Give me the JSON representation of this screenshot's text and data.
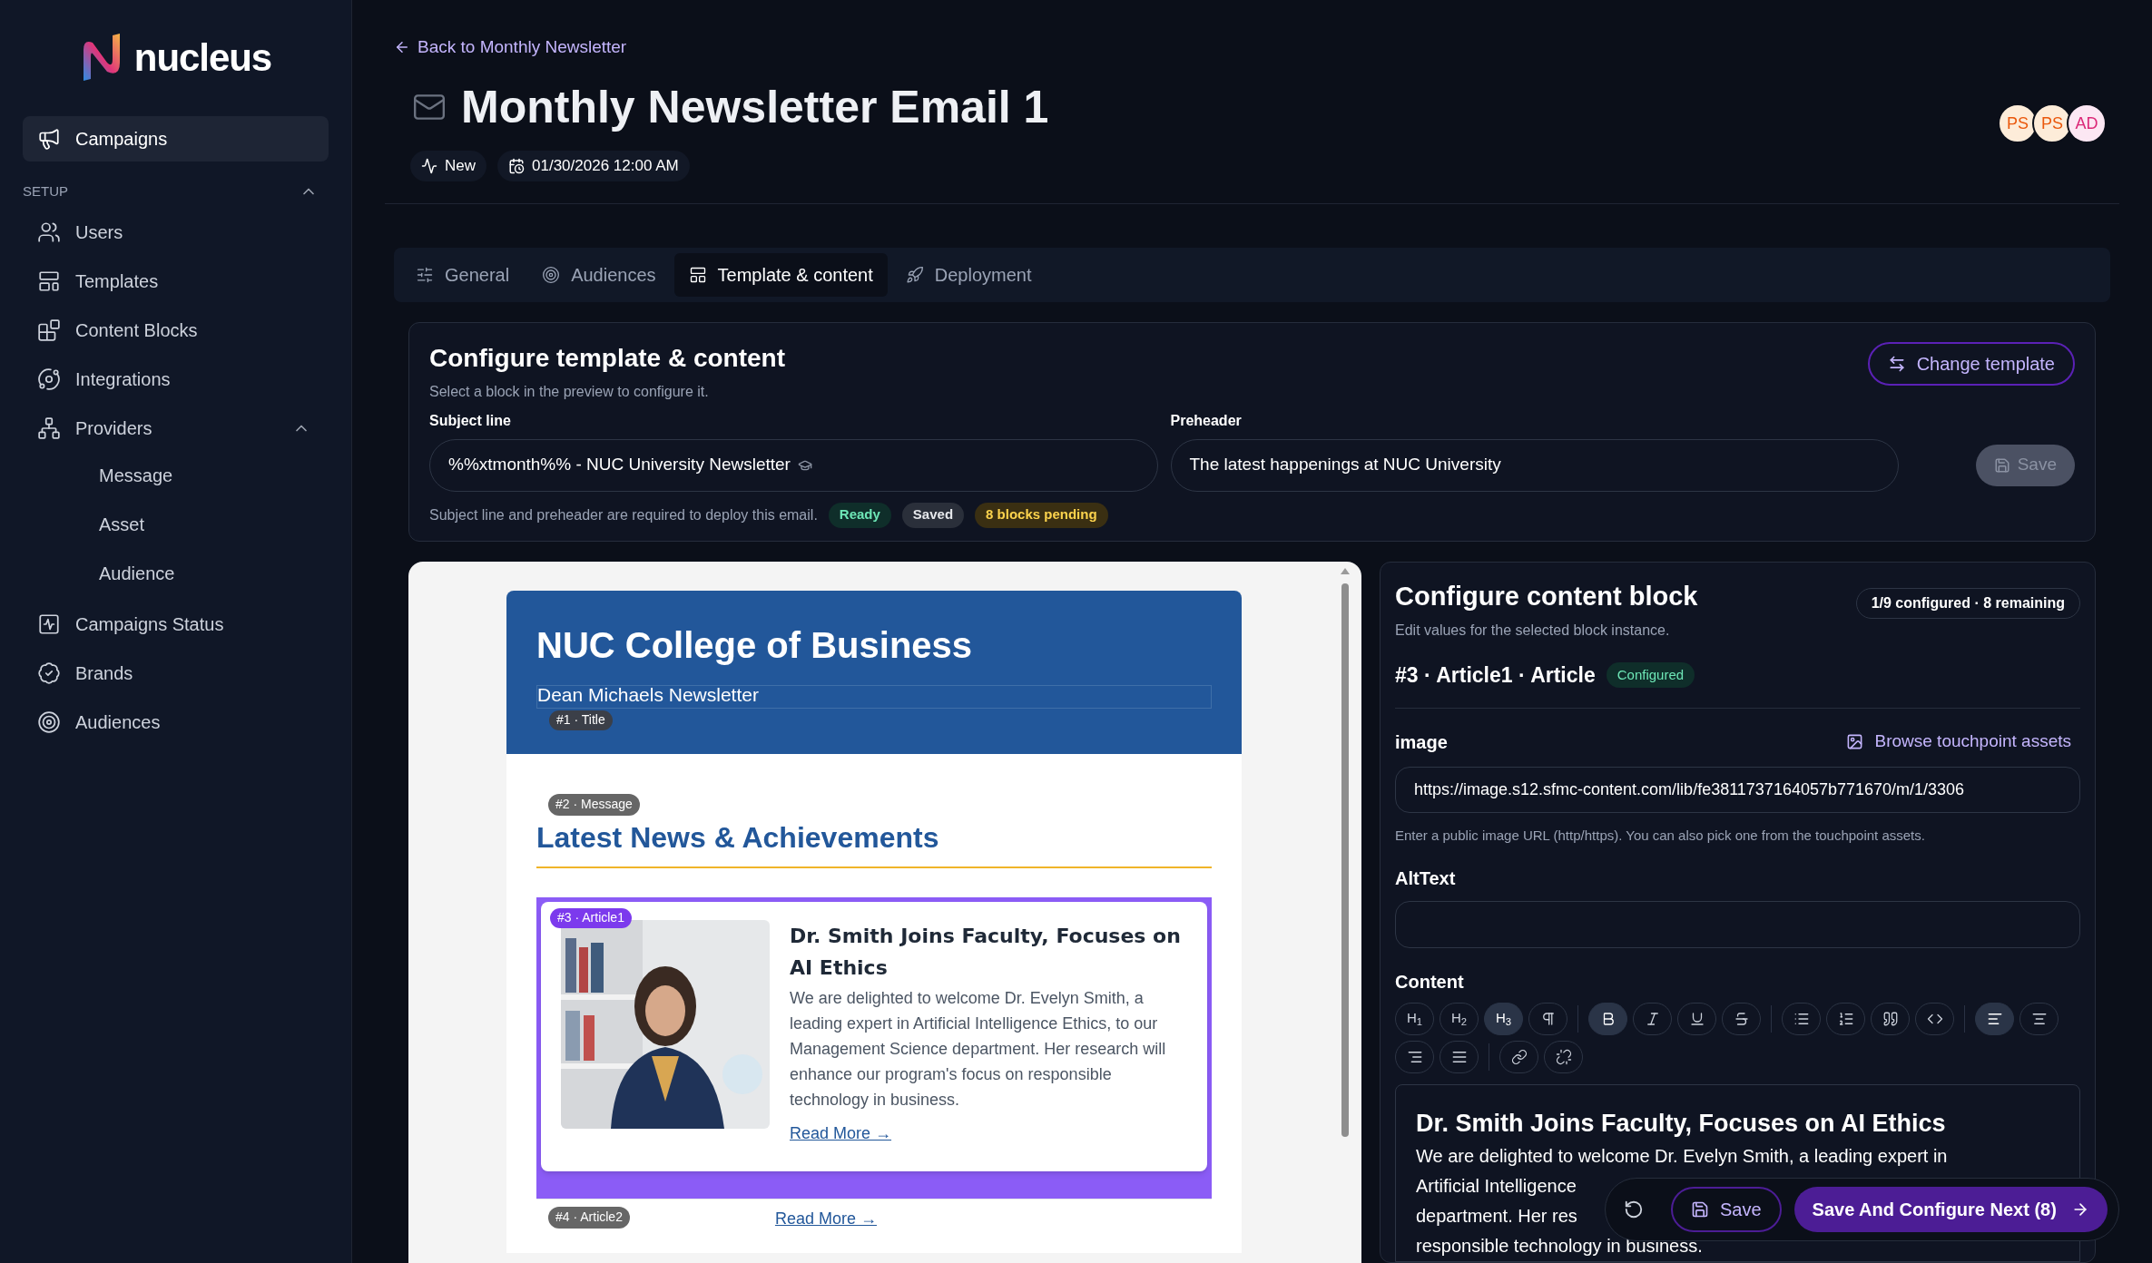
{
  "brand": {
    "name": "nucleus"
  },
  "sidebar": {
    "items": [
      {
        "label": "Campaigns",
        "selected": true
      }
    ],
    "section": {
      "title": "SETUP",
      "expanded": true,
      "items": [
        {
          "label": "Users",
          "selected": false
        },
        {
          "label": "Templates",
          "selected": false
        },
        {
          "label": "Content Blocks",
          "selected": false
        },
        {
          "label": "Integrations",
          "selected": false
        },
        {
          "label": "Providers",
          "selected": false,
          "expanded": true,
          "children": [
            {
              "label": "Message",
              "selected": false
            },
            {
              "label": "Asset",
              "selected": false
            },
            {
              "label": "Audience",
              "selected": false
            }
          ]
        },
        {
          "label": "Campaigns Status",
          "selected": false
        },
        {
          "label": "Brands",
          "selected": false
        },
        {
          "label": "Audiences",
          "selected": false
        }
      ]
    }
  },
  "header": {
    "back_link": "Back to Monthly Newsletter",
    "title": "Monthly Newsletter Email 1",
    "status": "New",
    "date": "01/30/2026 12:00 AM",
    "avatars": [
      {
        "initials": "PS",
        "color": "#ea580c"
      },
      {
        "initials": "PS",
        "color": "#ea580c"
      },
      {
        "initials": "AD",
        "color": "#db2777"
      }
    ]
  },
  "tabs": [
    {
      "label": "General",
      "selected": false
    },
    {
      "label": "Audiences",
      "selected": false
    },
    {
      "label": "Template & content",
      "selected": true
    },
    {
      "label": "Deployment",
      "selected": false
    }
  ],
  "config": {
    "title": "Configure template & content",
    "subtitle": "Select a block in the preview to configure it.",
    "change_button": "Change template",
    "subject": {
      "label": "Subject line",
      "value": "%%xtmonth%% - NUC University Newsletter"
    },
    "preheader": {
      "label": "Preheader",
      "value": "The latest happenings at NUC University"
    },
    "save_button": {
      "label": "Save",
      "disabled": true
    },
    "note": "Subject line and preheader are required to deploy this email.",
    "badges": [
      {
        "label": "Ready",
        "kind": "success"
      },
      {
        "label": "Saved",
        "kind": "neutral"
      },
      {
        "label": "8 blocks pending",
        "kind": "warning"
      }
    ]
  },
  "preview": {
    "header_title": "NUC College of Business",
    "header_subtitle": "Dean Michaels Newsletter",
    "title_tag": "#1 · Title",
    "message_tag": "#2 · Message",
    "section_title": "Latest News & Achievements",
    "articles": [
      {
        "tag": "#3 · Article1",
        "selected": true,
        "title": "Dr. Smith Joins Faculty, Focuses on AI Ethics",
        "body": "We are delighted to welcome Dr. Evelyn Smith, a leading expert in Artificial Intelligence Ethics, to our Management Science department. Her research will enhance our program's focus on responsible technology in business.",
        "link": "Read More →"
      },
      {
        "tag": "#4 · Article2",
        "selected": false,
        "link": "Read More →"
      }
    ]
  },
  "block_panel": {
    "title": "Configure content block",
    "subtitle": "Edit values for the selected block instance.",
    "progress": "1/9 configured · 8 remaining",
    "block_name": "#3 · Article1 · Article",
    "block_status": "Configured",
    "image": {
      "label": "image",
      "browse_link": "Browse touchpoint assets",
      "value": "https://image.s12.sfmc-content.com/lib/fe3811737164057b771670/m/1/3306",
      "hint": "Enter a public image URL (http/https). You can also pick one from the touchpoint assets."
    },
    "alt_text": {
      "label": "AltText"
    },
    "content": {
      "label": "Content",
      "toolbar": [
        {
          "kind": "h1",
          "label": "H$_{1}$",
          "active": false
        },
        {
          "kind": "h2",
          "label": "H$_{2}$",
          "active": false
        },
        {
          "kind": "h3",
          "label": "H$_{3}$",
          "active": true
        },
        {
          "kind": "paragraph",
          "active": false
        },
        {
          "kind": "separator"
        },
        {
          "kind": "bold",
          "active": true
        },
        {
          "kind": "italic",
          "active": false
        },
        {
          "kind": "underline",
          "active": false
        },
        {
          "kind": "strike",
          "active": false
        },
        {
          "kind": "separator"
        },
        {
          "kind": "bullets",
          "active": false
        },
        {
          "kind": "numbers",
          "active": false
        },
        {
          "kind": "quote",
          "active": false
        },
        {
          "kind": "code",
          "active": false
        },
        {
          "kind": "separator"
        },
        {
          "kind": "align-left",
          "active": true
        },
        {
          "kind": "align-center",
          "active": false
        },
        {
          "kind": "align-right",
          "active": false
        },
        {
          "kind": "justify",
          "active": false
        },
        {
          "kind": "separator"
        },
        {
          "kind": "link",
          "active": false
        },
        {
          "kind": "unlink",
          "active": false
        }
      ],
      "heading": "Dr. Smith Joins Faculty, Focuses on AI Ethics",
      "lines": [
        "We are delighted to welcome Dr. Evelyn Smith, a leading expert in",
        "Artificial Intelligence",
        "department. Her res",
        "responsible technology in business."
      ]
    }
  },
  "action_bar": {
    "save": "Save",
    "next": "Save And Configure Next (8)"
  }
}
